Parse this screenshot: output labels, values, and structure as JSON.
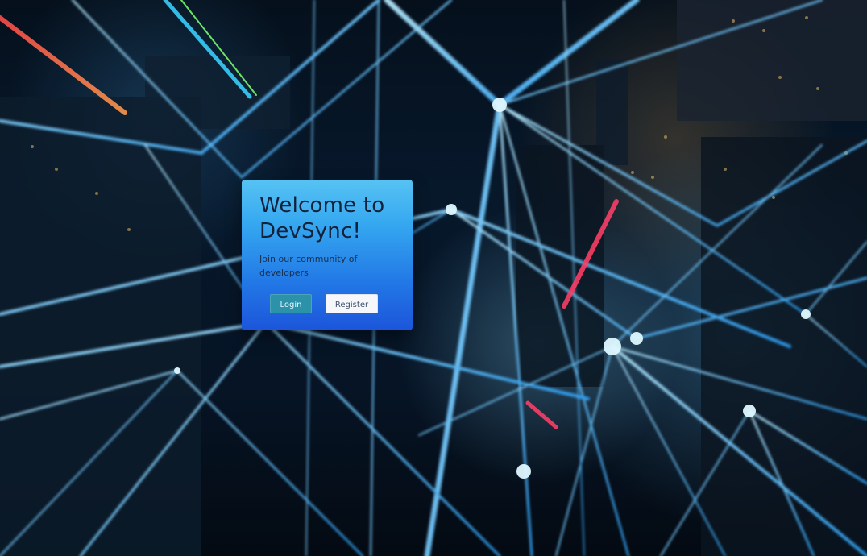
{
  "card": {
    "title": "Welcome to DevSync!",
    "subtitle": "Join our community of developers",
    "login_label": "Login",
    "register_label": "Register"
  },
  "theme": {
    "card_top": "#56c3f3",
    "card_bottom": "#1c55da",
    "login_bg": "#2c92aa",
    "register_bg": "#f5f7fa"
  }
}
